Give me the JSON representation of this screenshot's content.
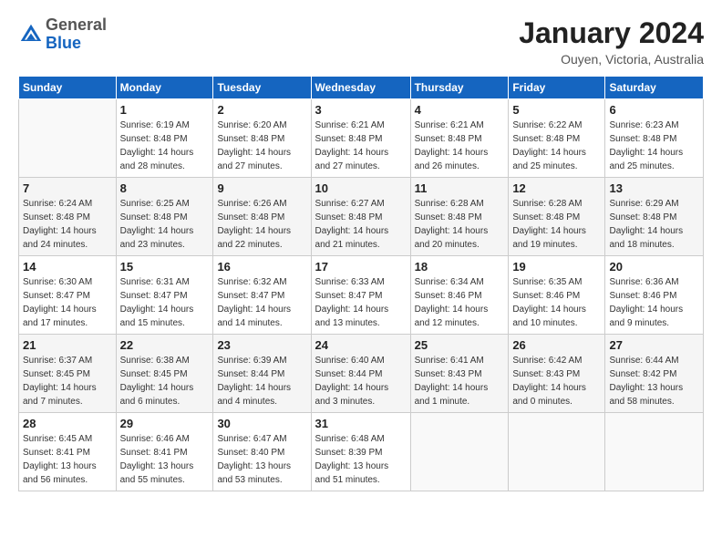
{
  "logo": {
    "general": "General",
    "blue": "Blue"
  },
  "title": "January 2024",
  "location": "Ouyen, Victoria, Australia",
  "days_of_week": [
    "Sunday",
    "Monday",
    "Tuesday",
    "Wednesday",
    "Thursday",
    "Friday",
    "Saturday"
  ],
  "weeks": [
    [
      {
        "day": "",
        "info": ""
      },
      {
        "day": "1",
        "info": "Sunrise: 6:19 AM\nSunset: 8:48 PM\nDaylight: 14 hours\nand 28 minutes."
      },
      {
        "day": "2",
        "info": "Sunrise: 6:20 AM\nSunset: 8:48 PM\nDaylight: 14 hours\nand 27 minutes."
      },
      {
        "day": "3",
        "info": "Sunrise: 6:21 AM\nSunset: 8:48 PM\nDaylight: 14 hours\nand 27 minutes."
      },
      {
        "day": "4",
        "info": "Sunrise: 6:21 AM\nSunset: 8:48 PM\nDaylight: 14 hours\nand 26 minutes."
      },
      {
        "day": "5",
        "info": "Sunrise: 6:22 AM\nSunset: 8:48 PM\nDaylight: 14 hours\nand 25 minutes."
      },
      {
        "day": "6",
        "info": "Sunrise: 6:23 AM\nSunset: 8:48 PM\nDaylight: 14 hours\nand 25 minutes."
      }
    ],
    [
      {
        "day": "7",
        "info": "Sunrise: 6:24 AM\nSunset: 8:48 PM\nDaylight: 14 hours\nand 24 minutes."
      },
      {
        "day": "8",
        "info": "Sunrise: 6:25 AM\nSunset: 8:48 PM\nDaylight: 14 hours\nand 23 minutes."
      },
      {
        "day": "9",
        "info": "Sunrise: 6:26 AM\nSunset: 8:48 PM\nDaylight: 14 hours\nand 22 minutes."
      },
      {
        "day": "10",
        "info": "Sunrise: 6:27 AM\nSunset: 8:48 PM\nDaylight: 14 hours\nand 21 minutes."
      },
      {
        "day": "11",
        "info": "Sunrise: 6:28 AM\nSunset: 8:48 PM\nDaylight: 14 hours\nand 20 minutes."
      },
      {
        "day": "12",
        "info": "Sunrise: 6:28 AM\nSunset: 8:48 PM\nDaylight: 14 hours\nand 19 minutes."
      },
      {
        "day": "13",
        "info": "Sunrise: 6:29 AM\nSunset: 8:48 PM\nDaylight: 14 hours\nand 18 minutes."
      }
    ],
    [
      {
        "day": "14",
        "info": "Sunrise: 6:30 AM\nSunset: 8:47 PM\nDaylight: 14 hours\nand 17 minutes."
      },
      {
        "day": "15",
        "info": "Sunrise: 6:31 AM\nSunset: 8:47 PM\nDaylight: 14 hours\nand 15 minutes."
      },
      {
        "day": "16",
        "info": "Sunrise: 6:32 AM\nSunset: 8:47 PM\nDaylight: 14 hours\nand 14 minutes."
      },
      {
        "day": "17",
        "info": "Sunrise: 6:33 AM\nSunset: 8:47 PM\nDaylight: 14 hours\nand 13 minutes."
      },
      {
        "day": "18",
        "info": "Sunrise: 6:34 AM\nSunset: 8:46 PM\nDaylight: 14 hours\nand 12 minutes."
      },
      {
        "day": "19",
        "info": "Sunrise: 6:35 AM\nSunset: 8:46 PM\nDaylight: 14 hours\nand 10 minutes."
      },
      {
        "day": "20",
        "info": "Sunrise: 6:36 AM\nSunset: 8:46 PM\nDaylight: 14 hours\nand 9 minutes."
      }
    ],
    [
      {
        "day": "21",
        "info": "Sunrise: 6:37 AM\nSunset: 8:45 PM\nDaylight: 14 hours\nand 7 minutes."
      },
      {
        "day": "22",
        "info": "Sunrise: 6:38 AM\nSunset: 8:45 PM\nDaylight: 14 hours\nand 6 minutes."
      },
      {
        "day": "23",
        "info": "Sunrise: 6:39 AM\nSunset: 8:44 PM\nDaylight: 14 hours\nand 4 minutes."
      },
      {
        "day": "24",
        "info": "Sunrise: 6:40 AM\nSunset: 8:44 PM\nDaylight: 14 hours\nand 3 minutes."
      },
      {
        "day": "25",
        "info": "Sunrise: 6:41 AM\nSunset: 8:43 PM\nDaylight: 14 hours\nand 1 minute."
      },
      {
        "day": "26",
        "info": "Sunrise: 6:42 AM\nSunset: 8:43 PM\nDaylight: 14 hours\nand 0 minutes."
      },
      {
        "day": "27",
        "info": "Sunrise: 6:44 AM\nSunset: 8:42 PM\nDaylight: 13 hours\nand 58 minutes."
      }
    ],
    [
      {
        "day": "28",
        "info": "Sunrise: 6:45 AM\nSunset: 8:41 PM\nDaylight: 13 hours\nand 56 minutes."
      },
      {
        "day": "29",
        "info": "Sunrise: 6:46 AM\nSunset: 8:41 PM\nDaylight: 13 hours\nand 55 minutes."
      },
      {
        "day": "30",
        "info": "Sunrise: 6:47 AM\nSunset: 8:40 PM\nDaylight: 13 hours\nand 53 minutes."
      },
      {
        "day": "31",
        "info": "Sunrise: 6:48 AM\nSunset: 8:39 PM\nDaylight: 13 hours\nand 51 minutes."
      },
      {
        "day": "",
        "info": ""
      },
      {
        "day": "",
        "info": ""
      },
      {
        "day": "",
        "info": ""
      }
    ]
  ]
}
